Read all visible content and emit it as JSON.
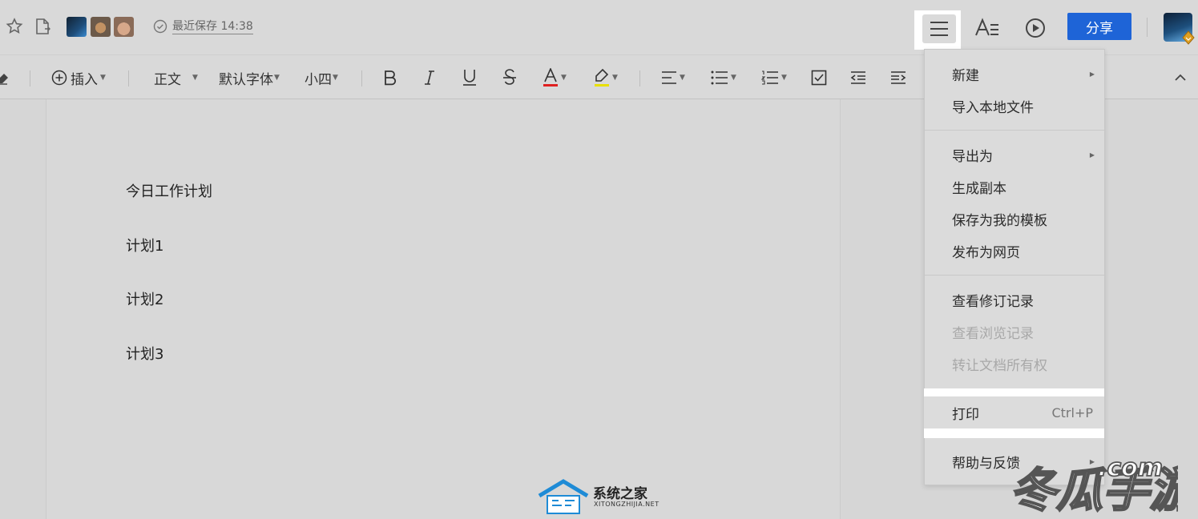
{
  "header": {
    "save_status": "最近保存 14:38",
    "share_label": "分享"
  },
  "toolbar": {
    "insert_label": "插入",
    "style_value": "正文",
    "font_value": "默认字体",
    "size_value": "小四"
  },
  "document": {
    "lines": [
      "今日工作计划",
      "计划1",
      "计划2",
      "计划3"
    ]
  },
  "menu": {
    "items": [
      {
        "label": "新建",
        "has_submenu": true
      },
      {
        "label": "导入本地文件"
      },
      {
        "label": "导出为",
        "has_submenu": true
      },
      {
        "label": "生成副本"
      },
      {
        "label": "保存为我的模板"
      },
      {
        "label": "发布为网页"
      },
      {
        "label": "查看修订记录"
      },
      {
        "label": "查看浏览记录",
        "disabled": true
      },
      {
        "label": "转让文档所有权",
        "disabled": true
      },
      {
        "label": "打印",
        "shortcut": "Ctrl+P"
      },
      {
        "label": "帮助与反馈",
        "has_submenu": true
      }
    ]
  },
  "watermarks": {
    "left_title": "系统之家",
    "left_sub": "XITONGZHIJIA.NET",
    "right_text": "冬瓜手游",
    "right_com": ".com"
  },
  "colors": {
    "accent": "#1e64d7",
    "font_color_bar": "#e02020",
    "highlight_bar": "#e8e000"
  }
}
